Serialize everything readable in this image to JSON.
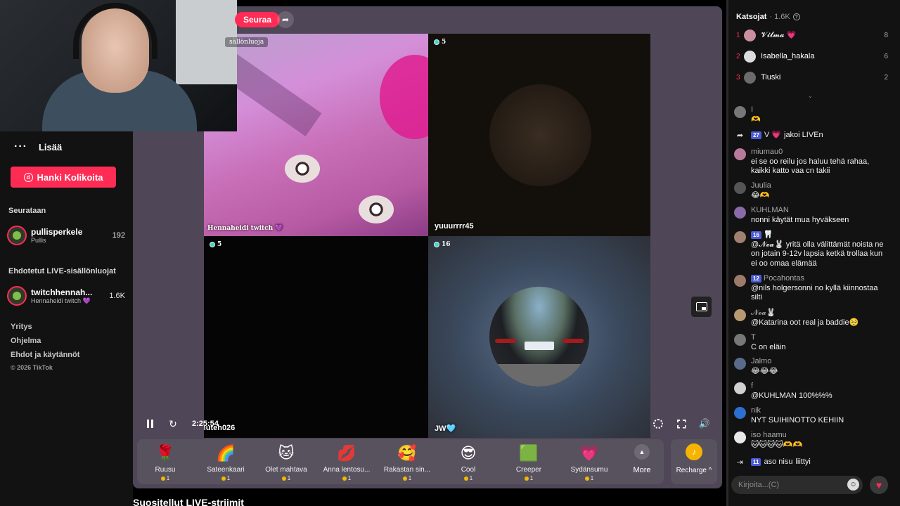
{
  "sidebar": {
    "more_label": "Lisää",
    "coins_button": "Hanki Kolikoita",
    "following_title": "Seurataan",
    "following": [
      {
        "name": "pullisperkele",
        "sub": "Pullis",
        "count": "192"
      }
    ],
    "suggested_title": "Ehdotetut LIVE-sisällönluojat",
    "suggested": [
      {
        "name": "twitchhennah...",
        "sub": "Hennaheidi twitch 💜",
        "count": "1.6K"
      }
    ],
    "links": [
      "Yritys",
      "Ohjelma",
      "Ehdot ja käytännöt"
    ],
    "copyright": "© 2026 TikTok"
  },
  "stage": {
    "follow_button": "Seuraa",
    "host_label": "sällönluoja",
    "tiles": [
      {
        "name": "Hennaheidi twitch 💜",
        "badge": ""
      },
      {
        "name": "yuuurrrr45",
        "badge": "5"
      },
      {
        "name": "nuteh026",
        "badge": "5"
      },
      {
        "name": "JW🩵",
        "badge": "16"
      }
    ],
    "time": "2:25:54"
  },
  "gifts": [
    {
      "name": "Ruusu",
      "price": "1",
      "icon": "🌹"
    },
    {
      "name": "Sateenkaari",
      "price": "1",
      "icon": "🌈"
    },
    {
      "name": "Olet mahtava",
      "price": "1",
      "icon": "🐱"
    },
    {
      "name": "Anna lentosu...",
      "price": "1",
      "icon": "💋"
    },
    {
      "name": "Rakastan sin...",
      "price": "1",
      "icon": "🥰"
    },
    {
      "name": "Cool",
      "price": "1",
      "icon": "😎"
    },
    {
      "name": "Creeper",
      "price": "1",
      "icon": "🟩"
    },
    {
      "name": "Sydänsumu",
      "price": "1",
      "icon": "💗"
    }
  ],
  "more_gifts": "More",
  "recharge": "Recharge ^",
  "suggested_streams": "Suositellut LIVE-striimit",
  "chat": {
    "viewers_title": "Katsojat",
    "viewers_count": "· 1.6K",
    "top_viewers": [
      {
        "rank": "1",
        "name": "𝓥𝓲𝓵𝓶𝓪 💗",
        "score": "8",
        "color": "#c98fa0"
      },
      {
        "rank": "2",
        "name": "Isabella_hakala",
        "score": "6",
        "color": "#dcdcdc"
      },
      {
        "rank": "3",
        "name": "Tiuski",
        "score": "2",
        "color": "#6b6b6b"
      }
    ],
    "messages": [
      {
        "user": "I",
        "level": "",
        "text": "🫶",
        "color": "#777"
      },
      {
        "user": "V 💗",
        "level": "27",
        "text": "jakoi LIVEn",
        "system": true
      },
      {
        "user": "miumau0",
        "level": "",
        "text": "ei se oo reilu jos haluu tehä rahaa, kaikki katto vaa cn takii",
        "color": "#b87a9a"
      },
      {
        "user": "Juulia",
        "level": "",
        "text": "😂🫶",
        "color": "#555"
      },
      {
        "user": "KUHLMAN",
        "level": "",
        "text": "nonni käytät mua hyväkseen",
        "color": "#8a6aa8"
      },
      {
        "user": "🦷",
        "level": "16",
        "text": "@𝓝𝓮𝓪🐰 yritä olla välittämät noista ne on jotain 9-12v lapsia ketkä trollaa kun ei oo omaa elämää",
        "color": "#a08070"
      },
      {
        "user": "Pocahontas",
        "level": "12",
        "text": "@nils holgersonni no kyllä kiinnostaa silti",
        "color": "#9c7b6a"
      },
      {
        "user": "𝓝𝓮𝓪🐰",
        "level": "",
        "text": "@Katarina oot real ja baddie🥺",
        "color": "#b89a70"
      },
      {
        "user": "T",
        "level": "",
        "text": "C on eläin",
        "color": "#777"
      },
      {
        "user": "Jalmo",
        "level": "",
        "text": "😂😂😂",
        "color": "#5a6a8a"
      },
      {
        "user": "f",
        "level": "",
        "text": "@KUHLMAN 100%%%",
        "color": "#cfcfcf"
      },
      {
        "user": "nik",
        "level": "",
        "text": "NYT SUIHINOTTO KEHIIN",
        "color": "#2d6fd0"
      },
      {
        "user": "iso haamu",
        "level": "",
        "text": "🐱🐱🐱🐱🫶🫶",
        "color": "#e8e8e8"
      },
      {
        "user": "aso nisu",
        "level": "11",
        "text": "liittyi",
        "system": true
      }
    ],
    "input_placeholder": "Kirjoita...(C)"
  }
}
